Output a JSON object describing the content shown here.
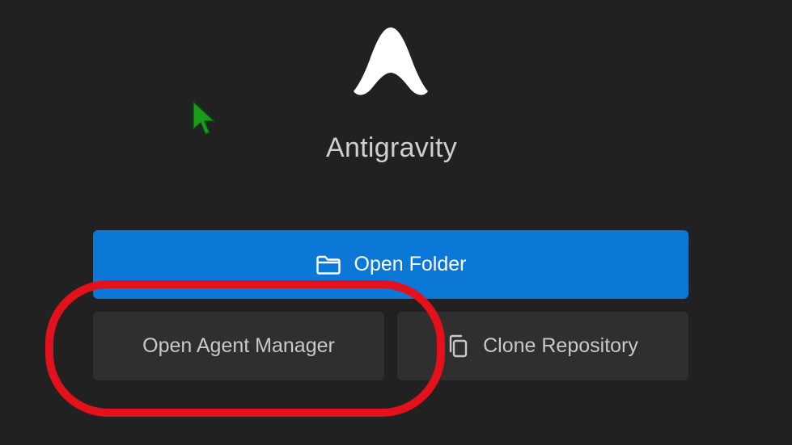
{
  "app": {
    "title": "Antigravity",
    "logo_icon": "antigravity-logo-icon"
  },
  "actions": {
    "open_folder": {
      "label": "Open Folder",
      "icon": "folder-icon"
    },
    "open_agent_manager": {
      "label": "Open Agent Manager"
    },
    "clone_repository": {
      "label": "Clone Repository",
      "icon": "copy-icon"
    }
  },
  "overlay": {
    "cursor": "pointer-cursor-icon",
    "highlight": "red-highlight-ring"
  },
  "colors": {
    "background": "#212121",
    "primary_button": "#0b78d7",
    "secondary_button": "#2f2f2f",
    "highlight": "#e3111b",
    "cursor": "#1d9a1d"
  }
}
